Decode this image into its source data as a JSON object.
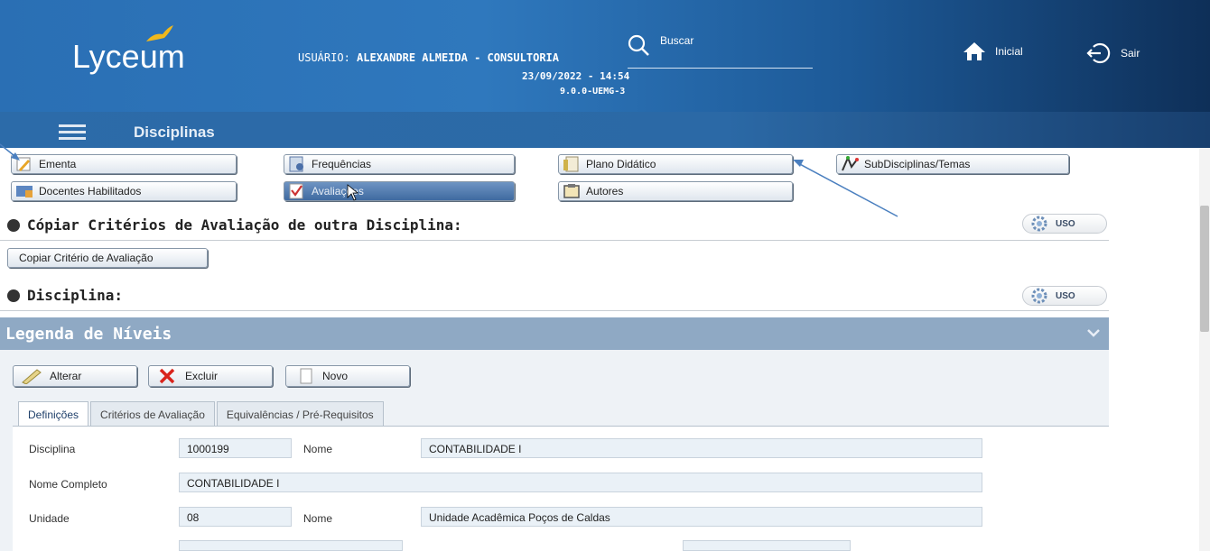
{
  "header": {
    "logo": "Lyceum",
    "user_label": "USUÁRIO:",
    "user_name": "ALEXANDRE ALMEIDA - CONSULTORIA",
    "datetime": "23/09/2022 - 14:54",
    "version": "9.0.0-UEMG-3",
    "search_label": "Buscar",
    "home_label": "Inicial",
    "exit_label": "Sair"
  },
  "subbar": {
    "title": "Disciplinas"
  },
  "function_buttons": {
    "ementa": "Ementa",
    "frequencias": "Frequências",
    "plano": "Plano Didático",
    "subdisciplinas": "SubDisciplinas/Temas",
    "docentes": "Docentes Habilitados",
    "avaliacoes": "Avaliações",
    "autores": "Autores"
  },
  "sections": {
    "copiar_title": "Cópiar Critérios de Avaliação de outra Disciplina:",
    "copiar_button": "Copiar Critério de Avaliação",
    "disciplina_title": "Disciplina:",
    "uso_label": "USO"
  },
  "legenda": {
    "title": "Legenda de Níveis",
    "alterar": "Alterar",
    "excluir": "Excluir",
    "novo": "Novo"
  },
  "tabs": [
    "Definições",
    "Critérios de Avaliação",
    "Equivalências / Pré-Requisitos"
  ],
  "form": {
    "disciplina_label": "Disciplina",
    "disciplina_value": "1000199",
    "nome_label": "Nome",
    "nome_value": "CONTABILIDADE I",
    "nome_completo_label": "Nome Completo",
    "nome_completo_value": "CONTABILIDADE I",
    "unidade_label": "Unidade",
    "unidade_value": "08",
    "nome2_label": "Nome",
    "nome2_value": "Unidade Acadêmica Poços de Caldas"
  },
  "colors": {
    "header_blue": "#2a6fb4",
    "panel_blue": "#8fa9c4",
    "field_bg": "#eaf1f7"
  }
}
